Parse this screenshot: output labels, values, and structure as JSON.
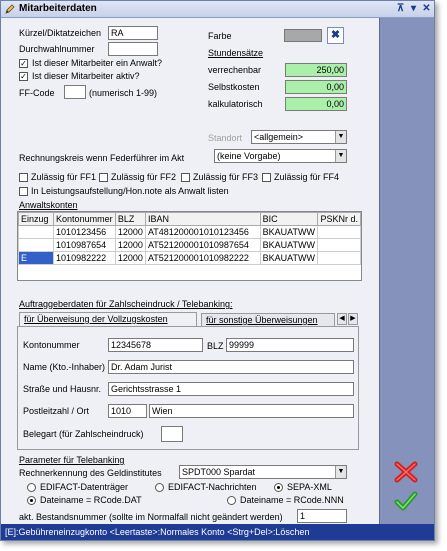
{
  "window": {
    "title": "Mitarbeiterdaten"
  },
  "form": {
    "kuerzel_label": "Kürzel/Diktatzeichen",
    "kuerzel_value": "RA",
    "durchwahl_label": "Durchwahlnummer",
    "durchwahl_value": "",
    "anwalt_label": "Ist dieser Mitarbeiter ein Anwalt?",
    "aktiv_label": "Ist dieser Mitarbeiter aktiv?",
    "ffcode_label": "FF-Code",
    "ffcode_value": "",
    "ffcode_hint": "(numerisch 1-99)",
    "farbe_label": "Farbe",
    "stundensaetze_label": "Stundensätze",
    "verrechenbar_label": "verrechenbar",
    "verrechenbar_value": "250,00",
    "selbstkosten_label": "Selbstkosten",
    "selbstkosten_value": "0,00",
    "kalkulatorisch_label": "kalkulatorisch",
    "kalkulatorisch_value": "0,00",
    "standort_label": "Standort",
    "standort_value": "<allgemein>",
    "rechnungskreis_label": "Rechnungskreis wenn Federführer im Akt",
    "rechnungskreis_value": "(keine Vorgabe)",
    "ff1_label": "Zulässig für FF1",
    "ff2_label": "Zulässig für FF2",
    "ff3_label": "Zulässig für FF3",
    "ff4_label": "Zulässig für FF4",
    "leistung_label": "In Leistungsaufstellung/Hon.note als Anwalt listen",
    "anwaltskonten_label": "Anwaltskonten"
  },
  "accounts": {
    "headers": [
      "Einzug",
      "Kontonummer",
      "BLZ",
      "IBAN",
      "BIC",
      "PSKNr d."
    ],
    "rows": [
      {
        "einzug": "",
        "konto": "1010123456",
        "blz": "12000",
        "iban": "AT481200001010123456",
        "bic": "BKAUATWW",
        "psk": ""
      },
      {
        "einzug": "",
        "konto": "1010987654",
        "blz": "12000",
        "iban": "AT521200001010987654",
        "bic": "BKAUATWW",
        "psk": ""
      },
      {
        "einzug": "E",
        "konto": "1010982222",
        "blz": "12000",
        "iban": "AT521200001010982222",
        "bic": "BKAUATWW",
        "psk": ""
      }
    ]
  },
  "auftraggeber": {
    "section_label": "Auftraggeberdaten für Zahlscheindruck / Telebanking:",
    "tab1": "für Überweisung der Vollzugskosten",
    "tab2": "für sonstige Überweisungen",
    "kontonummer_label": "Kontonummer",
    "kontonummer_value": "12345678",
    "blz_label": "BLZ",
    "blz_value": "99999",
    "name_label": "Name (Kto.-Inhaber)",
    "name_value": "Dr. Adam Jurist",
    "strasse_label": "Straße und Hausnr.",
    "strasse_value": "Gerichtsstrasse 1",
    "plz_label": "Postleitzahl / Ort",
    "plz_value": "1010",
    "ort_value": "Wien",
    "belegart_label": "Belegart (für Zahlscheindruck)",
    "belegart_value": ""
  },
  "telebanking": {
    "section_label": "Parameter für Telebanking",
    "rechner_label": "Rechnerkennung des Geldinstitutes",
    "rechner_value": "SPDT000 Spardat",
    "opt1": "EDIFACT-Datenträger",
    "opt2": "EDIFACT-Nachrichten",
    "opt3": "SEPA-XML",
    "file1": "Dateiname = RCode.DAT",
    "file2": "Dateiname = RCode.NNN",
    "bestand_label": "akt. Bestandsnummer (sollte im Normalfall nicht geändert werden)",
    "bestand_value": "1"
  },
  "status": {
    "text": "[E]:Gebühreneinzugkonto  <Leertaste>:Normales Konto  <Strg+Del>:Löschen"
  },
  "colors": {
    "accent_green": "#aaf0aa",
    "panel": "#8592bb",
    "statusbar": "#1e3c96",
    "cancel": "#d02020",
    "ok": "#2a9a2a"
  }
}
